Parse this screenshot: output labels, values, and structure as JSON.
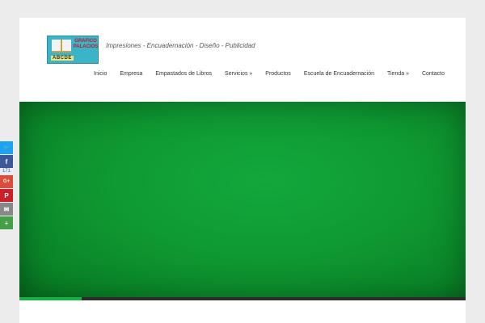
{
  "logo": {
    "brand_line1": "GRAFICO",
    "brand_line2": "PALACIOS",
    "letters": "ABCDE"
  },
  "tagline": "Impresiones - Encuadernación - Diseño - Publicidad",
  "nav": {
    "items": [
      {
        "label": "Inicio"
      },
      {
        "label": "Empresa"
      },
      {
        "label": "Empastados de Libros"
      },
      {
        "label": "Servicios »"
      },
      {
        "label": "Productos"
      },
      {
        "label": "Escuela de Encuadernación"
      },
      {
        "label": "Tienda »"
      },
      {
        "label": "Contacto"
      }
    ]
  },
  "slider": {
    "progress_fraction": 0.14,
    "background_color": "#0f9932",
    "progress_color": "#1ab043"
  },
  "share": {
    "twitter": {
      "icon": "twitter-icon",
      "color": "#1da1f2",
      "glyph": "🐦"
    },
    "facebook": {
      "icon": "facebook-icon",
      "color": "#3b5998",
      "glyph": "f",
      "count": "171"
    },
    "googleplus": {
      "icon": "google-plus-icon",
      "color": "#dd4b39",
      "glyph": "G+"
    },
    "pinterest": {
      "icon": "pinterest-icon",
      "color": "#cb2027",
      "glyph": "P"
    },
    "email": {
      "icon": "email-icon",
      "color": "#888888",
      "glyph": "✉"
    },
    "more": {
      "icon": "more-icon",
      "color": "#43a047",
      "glyph": "+"
    }
  }
}
